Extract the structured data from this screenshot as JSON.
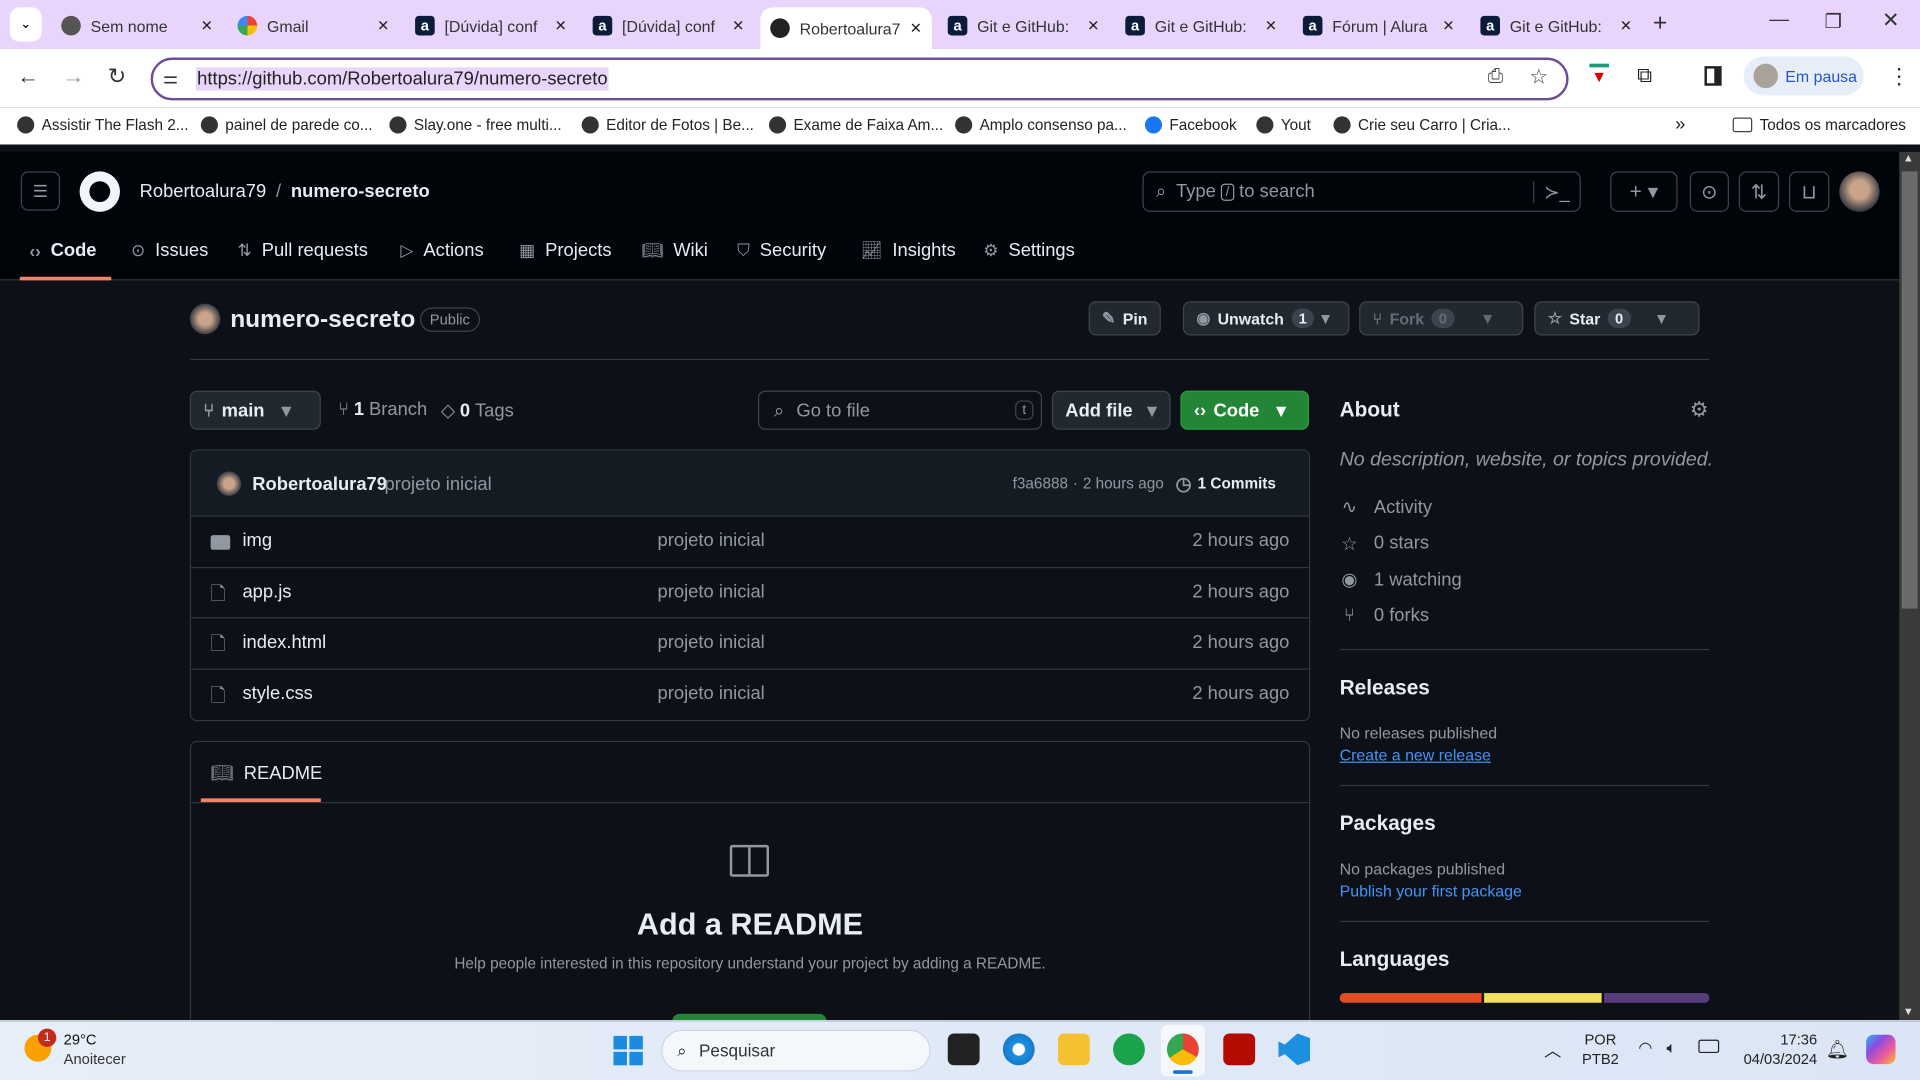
{
  "browser": {
    "tabs": [
      {
        "title": "Sem nome",
        "icon": "globe-icon"
      },
      {
        "title": "Gmail",
        "icon": "google-icon"
      },
      {
        "title": "[Dúvida] conf",
        "icon": "alura-icon"
      },
      {
        "title": "[Dúvida] conf",
        "icon": "alura-icon"
      },
      {
        "title": "Robertoalura79",
        "icon": "github-icon",
        "active": true
      },
      {
        "title": "Git e GitHub:",
        "icon": "alura-icon"
      },
      {
        "title": "Git e GitHub:",
        "icon": "alura-icon"
      },
      {
        "title": "Fórum | Alura",
        "icon": "alura-icon"
      },
      {
        "title": "Git e GitHub:",
        "icon": "alura-icon"
      }
    ],
    "url": "https://github.com/Robertoalura79/numero-secreto",
    "profile_label": "Em pausa",
    "bookmarks": [
      "Assistir The Flash 2...",
      "painel de parede co...",
      "Slay.one - free multi...",
      "Editor de Fotos | Be...",
      "Exame de Faixa Am...",
      "Amplo consenso pa...",
      "Facebook",
      "Yout",
      "Crie seu Carro | Cria..."
    ],
    "all_bookmarks": "Todos os marcadores"
  },
  "github": {
    "owner": "Robertoalura79",
    "sep": "/",
    "repo": "numero-secreto",
    "search_placeholder_pre": "Type",
    "search_key": "/",
    "search_placeholder_post": "to search",
    "nav": [
      "Code",
      "Issues",
      "Pull requests",
      "Actions",
      "Projects",
      "Wiki",
      "Security",
      "Insights",
      "Settings"
    ],
    "visibility": "Public",
    "pin": "Pin",
    "unwatch": "Unwatch",
    "watch_count": "1",
    "fork": "Fork",
    "fork_count": "0",
    "star": "Star",
    "star_count": "0",
    "branch": "main",
    "branches": "1",
    "branches_label": "Branch",
    "tags": "0",
    "tags_label": "Tags",
    "goto_placeholder": "Go to file",
    "goto_key": "t",
    "add_file": "Add file",
    "code": "Code",
    "commit": {
      "author": "Robertoalura79",
      "message": "projeto inicial",
      "hash": "f3a6888",
      "sep": "·",
      "time": "2 hours ago",
      "count": "1 Commits"
    },
    "files": [
      {
        "name": "img",
        "type": "folder",
        "message": "projeto inicial",
        "time": "2 hours ago"
      },
      {
        "name": "app.js",
        "type": "file",
        "message": "projeto inicial",
        "time": "2 hours ago"
      },
      {
        "name": "index.html",
        "type": "file",
        "message": "projeto inicial",
        "time": "2 hours ago"
      },
      {
        "name": "style.css",
        "type": "file",
        "message": "projeto inicial",
        "time": "2 hours ago"
      }
    ],
    "readme_tab": "README",
    "readme_title": "Add a README",
    "readme_desc": "Help people interested in this repository understand your project by adding a README.",
    "about": {
      "title": "About",
      "desc": "No description, website, or topics provided.",
      "items": [
        {
          "icon": "pulse-icon",
          "label": "Activity"
        },
        {
          "icon": "star-icon",
          "label": "0 stars"
        },
        {
          "icon": "eye-icon",
          "label": "1 watching"
        },
        {
          "icon": "fork-icon",
          "label": "0 forks"
        }
      ]
    },
    "releases": {
      "title": "Releases",
      "text": "No releases published",
      "link": "Create a new release"
    },
    "packages": {
      "title": "Packages",
      "text": "No packages published",
      "link": "Publish your first package"
    },
    "languages": {
      "title": "Languages",
      "bar": [
        {
          "color": "#e34c26",
          "share": 39
        },
        {
          "color": "#f1e05a",
          "share": 32
        },
        {
          "color": "#563d7c",
          "share": 29
        }
      ]
    }
  },
  "taskbar": {
    "temp": "29°C",
    "weather": "Anoitecer",
    "badge": "1",
    "search": "Pesquisar",
    "lang1": "POR",
    "lang2": "PTB2",
    "time": "17:36",
    "date": "04/03/2024"
  }
}
